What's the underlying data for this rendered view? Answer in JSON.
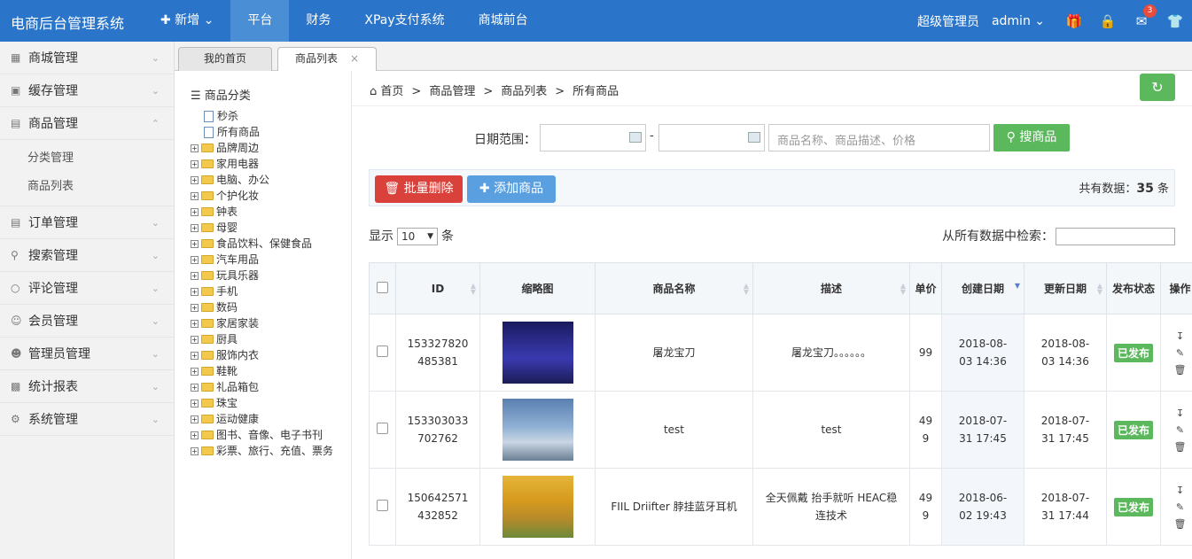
{
  "header": {
    "brand": "电商后台管理系统",
    "new_label": "✚ 新增 ⌄",
    "nav": [
      "平台",
      "财务",
      "XPay支付系统",
      "商城前台"
    ],
    "role": "超级管理员",
    "user": "admin ⌄",
    "message_count": "3"
  },
  "sidebar": {
    "items": [
      {
        "label": "商城管理",
        "icon": "grid-icon"
      },
      {
        "label": "缓存管理",
        "icon": "gamepad-icon"
      },
      {
        "label": "商品管理",
        "icon": "shopping-bag-icon"
      },
      {
        "label": "订单管理",
        "icon": "list-icon"
      },
      {
        "label": "搜索管理",
        "icon": "search-icon"
      },
      {
        "label": "评论管理",
        "icon": "comment-icon"
      },
      {
        "label": "会员管理",
        "icon": "users-icon"
      },
      {
        "label": "管理员管理",
        "icon": "user-icon"
      },
      {
        "label": "统计报表",
        "icon": "bar-chart-icon"
      },
      {
        "label": "系统管理",
        "icon": "gear-icon"
      }
    ],
    "sub_items": [
      "分类管理",
      "商品列表"
    ]
  },
  "tabs": {
    "home": "我的首页",
    "current": "商品列表",
    "close": "×"
  },
  "tree": {
    "title": "☰ 商品分类",
    "leaf_nodes": [
      "秒杀",
      "所有商品"
    ],
    "folders": [
      "品牌周边",
      "家用电器",
      "电脑、办公",
      "个护化妆",
      "钟表",
      "母婴",
      "食品饮料、保健食品",
      "汽车用品",
      "玩具乐器",
      "手机",
      "数码",
      "家居家装",
      "厨具",
      "服饰内衣",
      "鞋靴",
      "礼品箱包",
      "珠宝",
      "运动健康",
      "图书、音像、电子书刊",
      "彩票、旅行、充值、票务"
    ]
  },
  "breadcrumb": {
    "home": "首页",
    "items": [
      "商品管理",
      "商品列表",
      "所有商品"
    ],
    "sep": ">"
  },
  "search": {
    "date_label": "日期范围：",
    "dash": "-",
    "keyword_placeholder": "商品名称、商品描述、价格",
    "search_button": "搜商品"
  },
  "actions": {
    "batch_delete": "批量删除",
    "add_product": "添加商品",
    "total_prefix": "共有数据：",
    "total_count": "35",
    "total_suffix": " 条"
  },
  "pager": {
    "show_prefix": "显示",
    "page_size": "10",
    "show_suffix": "条",
    "filter_label": "从所有数据中检索："
  },
  "table": {
    "headers": [
      "ID",
      "缩略图",
      "商品名称",
      "描述",
      "单价",
      "创建日期",
      "更新日期",
      "发布状态",
      "操作"
    ],
    "rows": [
      {
        "id": "153327820485381",
        "name": "屠龙宝刀",
        "desc": "屠龙宝刀。。。。。。",
        "price": "99",
        "created": "2018-08-03 14:36",
        "updated": "2018-08-03 14:36",
        "status": "已发布"
      },
      {
        "id": "153303033702762",
        "name": "test",
        "desc": "test",
        "price": "499",
        "created": "2018-07-31 17:45",
        "updated": "2018-07-31 17:45",
        "status": "已发布"
      },
      {
        "id": "150642571432852",
        "name": "FIIL Driifter 脖挂蓝牙耳机",
        "desc": "全天佩戴 抬手就听 HEAC稳连技术",
        "price": "499",
        "created": "2018-06-02 19:43",
        "updated": "2018-07-31 17:44",
        "status": "已发布"
      }
    ]
  },
  "colors": {
    "topbar": "#2a75c9",
    "success": "#5cb85c",
    "danger": "#d9413a",
    "primary": "#5a9fe0"
  }
}
